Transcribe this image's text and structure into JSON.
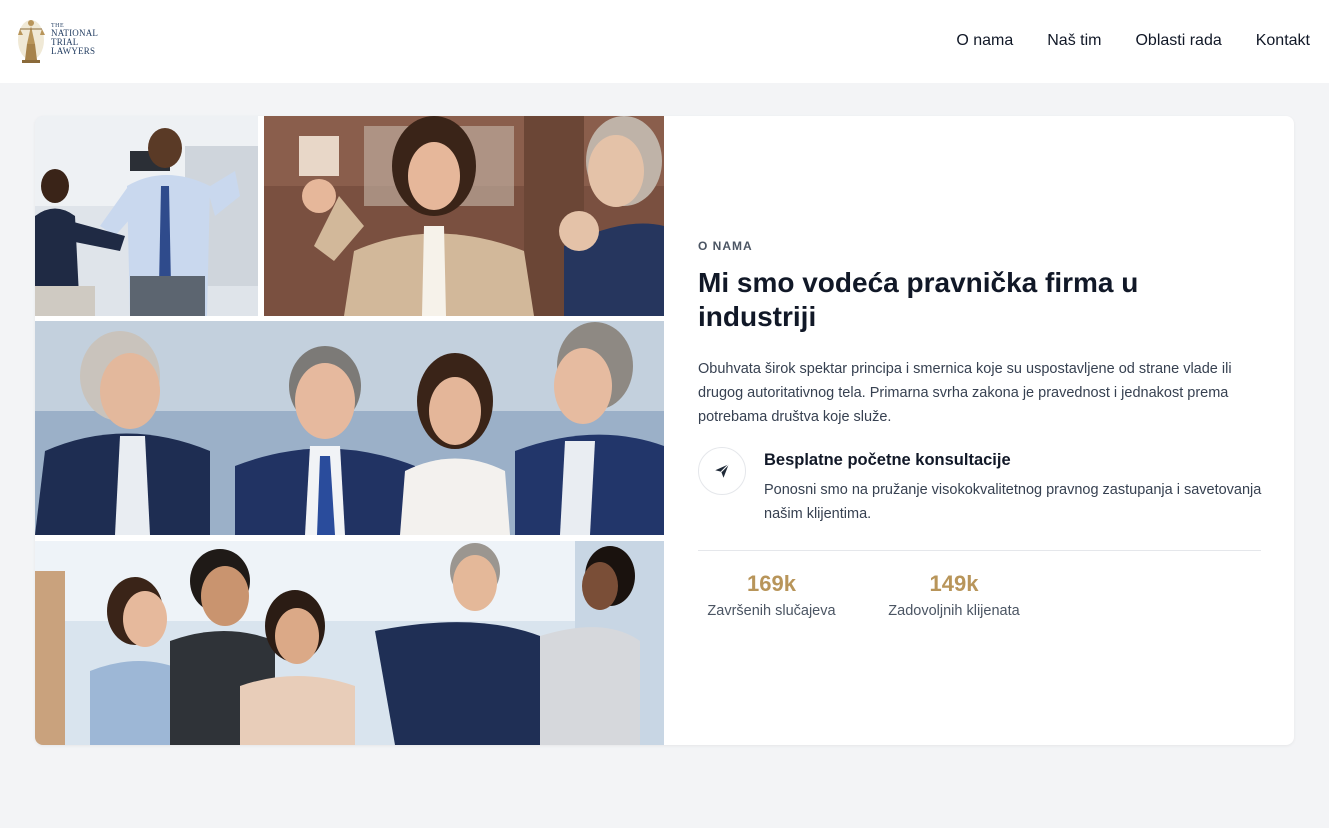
{
  "header": {
    "logo": {
      "line1": "THE",
      "line2": "NATIONAL",
      "line3": "TRIAL LAWYERS",
      "emblem_icon": "lady-justice-icon"
    },
    "nav": [
      "O nama",
      "Naš tim",
      "Oblasti rada",
      "Kontakt"
    ]
  },
  "about": {
    "eyebrow": "O NAMA",
    "title": "Mi smo vodeća pravnička firma u industriji",
    "description": "Obuhvata širok spektar principa i smernica koje su uspostavljene od strane vlade ili drugog autoritativnog tela. Primarna svrha zakona je pravednost i jednakost prema potrebama društva koje služe.",
    "feature": {
      "icon": "paper-plane-icon",
      "title": "Besplatne početne konsultacije",
      "description": "Ponosni smo na pružanje visokokvalitetnog pravnog zastupanja i savetovanja našim klijentima."
    },
    "stats": [
      {
        "value": "169k",
        "label": "Završenih slučajeva"
      },
      {
        "value": "149k",
        "label": "Zadovoljnih klijenata"
      }
    ]
  },
  "colors": {
    "accent": "#b8955a",
    "background": "#f3f4f6",
    "text": "#111827"
  }
}
